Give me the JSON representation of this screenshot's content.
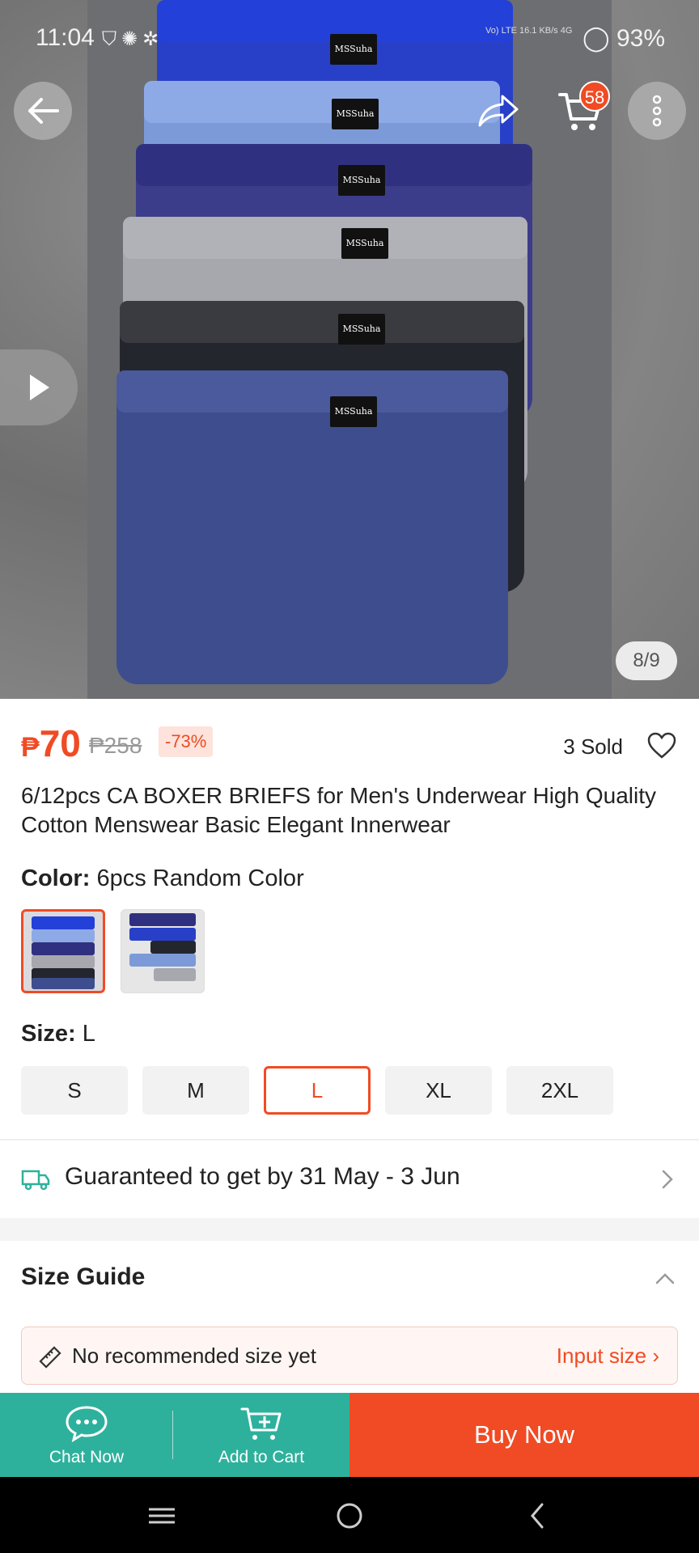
{
  "status_bar": {
    "time": "11:04",
    "network": "Vo) LTE 16.1 KB/s 4G",
    "battery": "93%",
    "left_icons": [
      "shield-icon",
      "chatgpt-icon",
      "settings-icon"
    ]
  },
  "header": {
    "cart_count": "58",
    "icons": [
      "back-arrow-icon",
      "share-icon",
      "cart-icon",
      "more-vertical-icon"
    ]
  },
  "gallery": {
    "page_indicator": "8/9",
    "brand_tag": "MSSuha",
    "current_index": 8,
    "total": 9
  },
  "product": {
    "currency": "₱",
    "price": "70",
    "original_price": "₱258",
    "discount": "-73%",
    "sold": "3 Sold",
    "title": "6/12pcs CA BOXER BRIEFS for Men's Underwear High Quality Cotton Menswear Basic Elegant Innerwear"
  },
  "color": {
    "label": "Color:",
    "value": "6pcs Random Color",
    "selected_index": 0
  },
  "size": {
    "label": "Size:",
    "value": "L",
    "options": [
      "S",
      "M",
      "L",
      "XL",
      "2XL"
    ],
    "selected": "L"
  },
  "delivery": {
    "text": "Guaranteed to get by 31 May - 3 Jun"
  },
  "size_guide": {
    "title": "Size Guide",
    "reco_text": "No recommended size yet",
    "input_link": "Input size"
  },
  "actions": {
    "chat": "Chat Now",
    "add_to_cart": "Add to Cart",
    "buy_now": "Buy Now"
  },
  "colors": {
    "accent": "#f04b24",
    "teal": "#2eb19c"
  }
}
